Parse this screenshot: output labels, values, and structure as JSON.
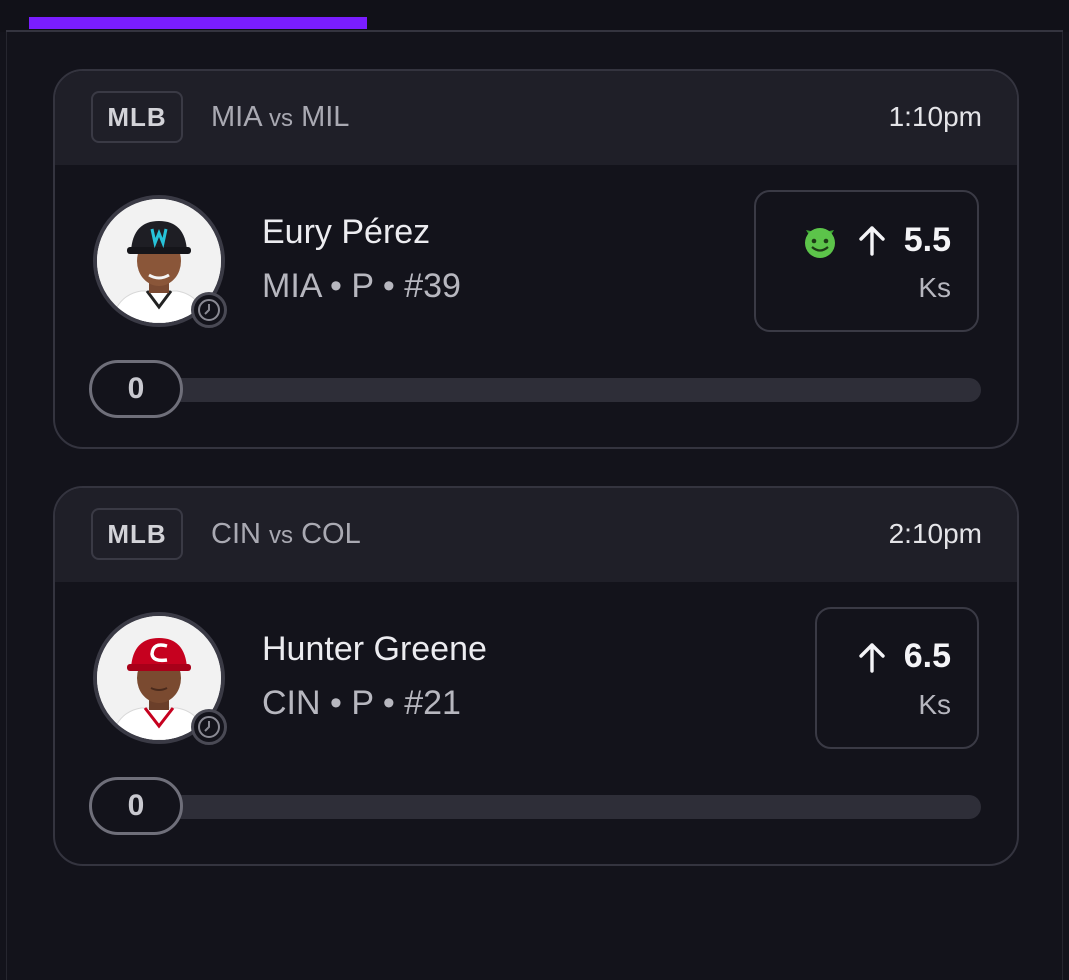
{
  "progress": 0.32,
  "colors": {
    "accent": "#7a1dff"
  },
  "cards": [
    {
      "league": "MLB",
      "home": "MIA",
      "vs": "vs",
      "away": "MIL",
      "time": "1:10pm",
      "player": {
        "name": "Eury Pérez",
        "meta": "MIA • P • #39",
        "cap_color": "#1e1e24",
        "jersey_color": "#ffffff"
      },
      "line": {
        "value": "5.5",
        "stat": "Ks",
        "direction_icon": "arrow-up-icon",
        "emoji_icon": "devil-icon"
      },
      "count": "0"
    },
    {
      "league": "MLB",
      "home": "CIN",
      "vs": "vs",
      "away": "COL",
      "time": "2:10pm",
      "player": {
        "name": "Hunter Greene",
        "meta": "CIN • P • #21",
        "cap_color": "#c6011f",
        "jersey_color": "#ffffff"
      },
      "line": {
        "value": "6.5",
        "stat": "Ks",
        "direction_icon": "arrow-up-icon"
      },
      "count": "0"
    }
  ]
}
